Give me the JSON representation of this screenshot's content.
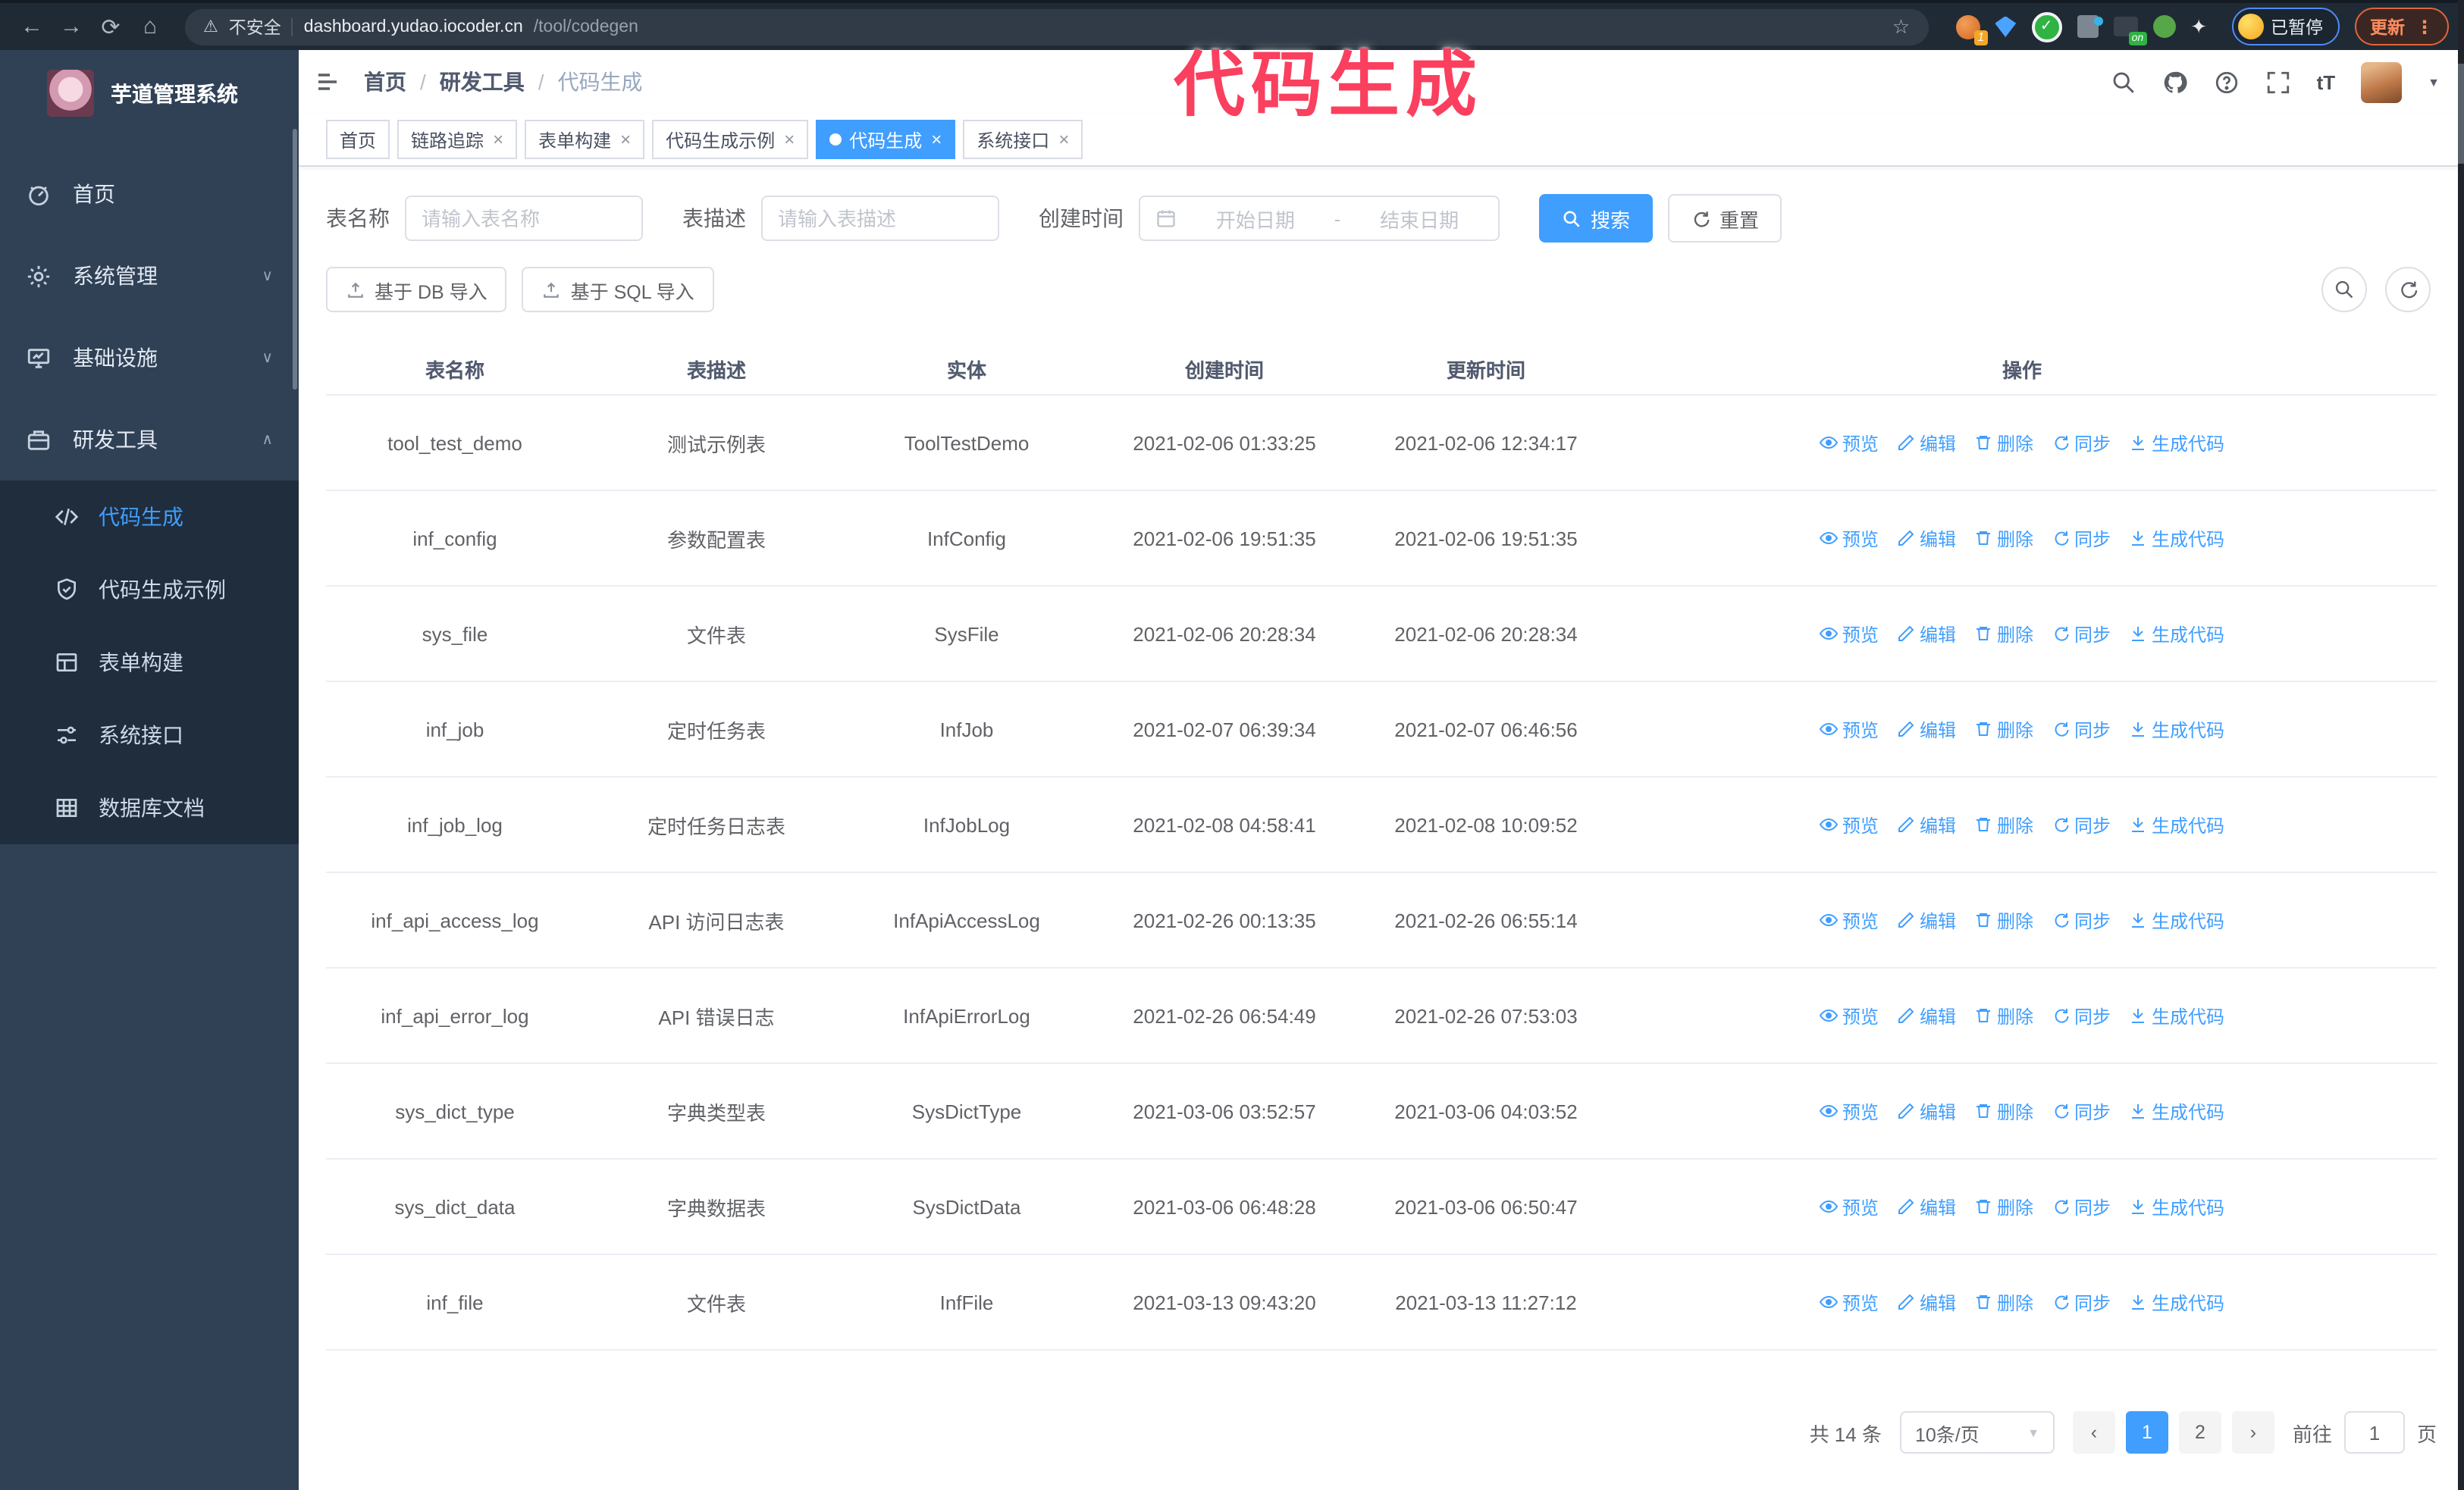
{
  "icons": {
    "back": "←",
    "forward": "→",
    "reload": "⟳",
    "home": "⌂",
    "warning": "⚠",
    "star": "☆",
    "kebab": "⋮",
    "check": "✓",
    "puzzle": "✦",
    "close": "×",
    "caret_down": "▼",
    "chevron_down": "∨",
    "chevron_up": "∧",
    "prev": "‹",
    "next": "›",
    "font_size": "tT"
  },
  "browser": {
    "security_label": "不安全",
    "url_host": "dashboard.yudao.iocoder.cn",
    "url_path": "/tool/codegen",
    "extension_badge": "1",
    "extension_on_badge": "on",
    "paused_badge": "已暂停",
    "update_button": "更新"
  },
  "annotation": {
    "text": "代码生成"
  },
  "sidebar": {
    "title": "芋道管理系统",
    "items": [
      {
        "label": "首页"
      },
      {
        "label": "系统管理"
      },
      {
        "label": "基础设施"
      },
      {
        "label": "研发工具"
      }
    ],
    "submenu": [
      {
        "label": "代码生成",
        "active": true
      },
      {
        "label": "代码生成示例"
      },
      {
        "label": "表单构建"
      },
      {
        "label": "系统接口"
      },
      {
        "label": "数据库文档"
      }
    ]
  },
  "breadcrumb": {
    "items": [
      "首页",
      "研发工具",
      "代码生成"
    ],
    "separator": "/"
  },
  "tabs": [
    {
      "label": "首页",
      "closable": false,
      "active": false
    },
    {
      "label": "链路追踪",
      "closable": true,
      "active": false
    },
    {
      "label": "表单构建",
      "closable": true,
      "active": false
    },
    {
      "label": "代码生成示例",
      "closable": true,
      "active": false
    },
    {
      "label": "代码生成",
      "closable": true,
      "active": true
    },
    {
      "label": "系统接口",
      "closable": true,
      "active": false
    }
  ],
  "filters": {
    "table_name_label": "表名称",
    "table_name_placeholder": "请输入表名称",
    "table_desc_label": "表描述",
    "table_desc_placeholder": "请输入表描述",
    "create_time_label": "创建时间",
    "start_placeholder": "开始日期",
    "range_separator": "-",
    "end_placeholder": "结束日期",
    "search_label": "搜索",
    "reset_label": "重置"
  },
  "toolbar": {
    "import_db_label": "基于 DB 导入",
    "import_sql_label": "基于 SQL 导入"
  },
  "table": {
    "columns": [
      "表名称",
      "表描述",
      "实体",
      "创建时间",
      "更新时间",
      "操作"
    ],
    "actions": [
      "预览",
      "编辑",
      "删除",
      "同步",
      "生成代码"
    ],
    "rows": [
      {
        "name": "tool_test_demo",
        "desc": "测试示例表",
        "entity": "ToolTestDemo",
        "create_time": "2021-02-06 01:33:25",
        "update_time": "2021-02-06 12:34:17"
      },
      {
        "name": "inf_config",
        "desc": "参数配置表",
        "entity": "InfConfig",
        "create_time": "2021-02-06 19:51:35",
        "update_time": "2021-02-06 19:51:35"
      },
      {
        "name": "sys_file",
        "desc": "文件表",
        "entity": "SysFile",
        "create_time": "2021-02-06 20:28:34",
        "update_time": "2021-02-06 20:28:34"
      },
      {
        "name": "inf_job",
        "desc": "定时任务表",
        "entity": "InfJob",
        "create_time": "2021-02-07 06:39:34",
        "update_time": "2021-02-07 06:46:56"
      },
      {
        "name": "inf_job_log",
        "desc": "定时任务日志表",
        "entity": "InfJobLog",
        "create_time": "2021-02-08 04:58:41",
        "update_time": "2021-02-08 10:09:52"
      },
      {
        "name": "inf_api_access_log",
        "desc": "API 访问日志表",
        "entity": "InfApiAccessLog",
        "create_time": "2021-02-26 00:13:35",
        "update_time": "2021-02-26 06:55:14"
      },
      {
        "name": "inf_api_error_log",
        "desc": "API 错误日志",
        "entity": "InfApiErrorLog",
        "create_time": "2021-02-26 06:54:49",
        "update_time": "2021-02-26 07:53:03"
      },
      {
        "name": "sys_dict_type",
        "desc": "字典类型表",
        "entity": "SysDictType",
        "create_time": "2021-03-06 03:52:57",
        "update_time": "2021-03-06 04:03:52"
      },
      {
        "name": "sys_dict_data",
        "desc": "字典数据表",
        "entity": "SysDictData",
        "create_time": "2021-03-06 06:48:28",
        "update_time": "2021-03-06 06:50:47"
      },
      {
        "name": "inf_file",
        "desc": "文件表",
        "entity": "InfFile",
        "create_time": "2021-03-13 09:43:20",
        "update_time": "2021-03-13 11:27:12"
      }
    ]
  },
  "pagination": {
    "total": "共 14 条",
    "page_size": "10条/页",
    "pages": [
      {
        "label": "1",
        "active": true
      },
      {
        "label": "2",
        "active": false
      }
    ],
    "goto_label": "前往",
    "goto_value": "1",
    "page_unit": "页"
  }
}
